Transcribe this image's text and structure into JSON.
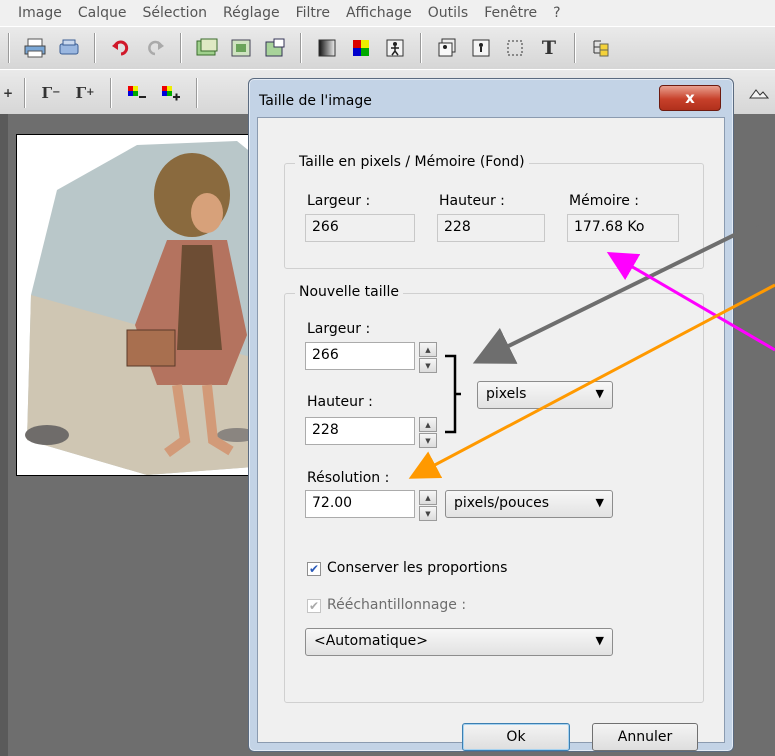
{
  "menu": [
    "Image",
    "Calque",
    "Sélection",
    "Réglage",
    "Filtre",
    "Affichage",
    "Outils",
    "Fenêtre",
    "?"
  ],
  "dialog": {
    "title": "Taille de l'image",
    "close_label": "x",
    "pixels_group": {
      "title": "Taille en pixels / Mémoire (Fond)",
      "width_label": "Largeur :",
      "width_value": "266",
      "height_label": "Hauteur :",
      "height_value": "228",
      "memory_label": "Mémoire :",
      "memory_value": "177.68 Ko"
    },
    "new_size_group": {
      "title": "Nouvelle taille",
      "width_label": "Largeur :",
      "width_value": "266",
      "height_label": "Hauteur :",
      "height_value": "228",
      "unit_selected": "pixels",
      "resolution_label": "Résolution :",
      "resolution_value": "72.00",
      "resolution_unit_selected": "pixels/pouces",
      "keep_proportions_label": "Conserver les proportions",
      "keep_proportions_checked": true,
      "resample_label": "Rééchantillonnage :",
      "resample_checked": true,
      "resample_method_selected": "<Automatique>"
    },
    "ok_label": "Ok",
    "cancel_label": "Annuler"
  },
  "annotation_colors": {
    "gray": "#6e6e6e",
    "magenta": "#ff00ff",
    "orange": "#ff9900"
  }
}
